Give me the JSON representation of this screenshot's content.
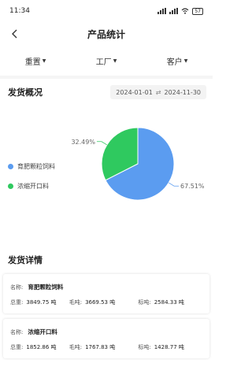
{
  "status_bar": {
    "time": "11:34",
    "battery": "57"
  },
  "nav": {
    "title": "产品统计"
  },
  "filters": [
    {
      "label": "重置"
    },
    {
      "label": "工厂"
    },
    {
      "label": "客户"
    }
  ],
  "overview": {
    "title": "发货概况",
    "date_start": "2024-01-01",
    "date_end": "2024-11-30"
  },
  "colors": {
    "blue": "#5b9cf0",
    "green": "#2fc95f"
  },
  "chart_data": {
    "type": "pie",
    "categories": [
      "育肥颗粒饲料",
      "浓缩开口料"
    ],
    "values": [
      67.51,
      32.49
    ],
    "labels": [
      "67.51%",
      "32.49%"
    ],
    "colors": [
      "#5b9cf0",
      "#2fc95f"
    ],
    "legend_position": "left"
  },
  "details": {
    "title": "发货详情",
    "name_label": "名称:",
    "total_label": "总重:",
    "gross_label": "毛吨:",
    "standard_label": "标吨:",
    "items": [
      {
        "name": "育肥颗粒饲料",
        "total": "3849.75 吨",
        "gross": "3669.53 吨",
        "standard": "2584.33 吨"
      },
      {
        "name": "浓缩开口料",
        "total": "1852.86 吨",
        "gross": "1767.83 吨",
        "standard": "1428.77 吨"
      }
    ]
  }
}
